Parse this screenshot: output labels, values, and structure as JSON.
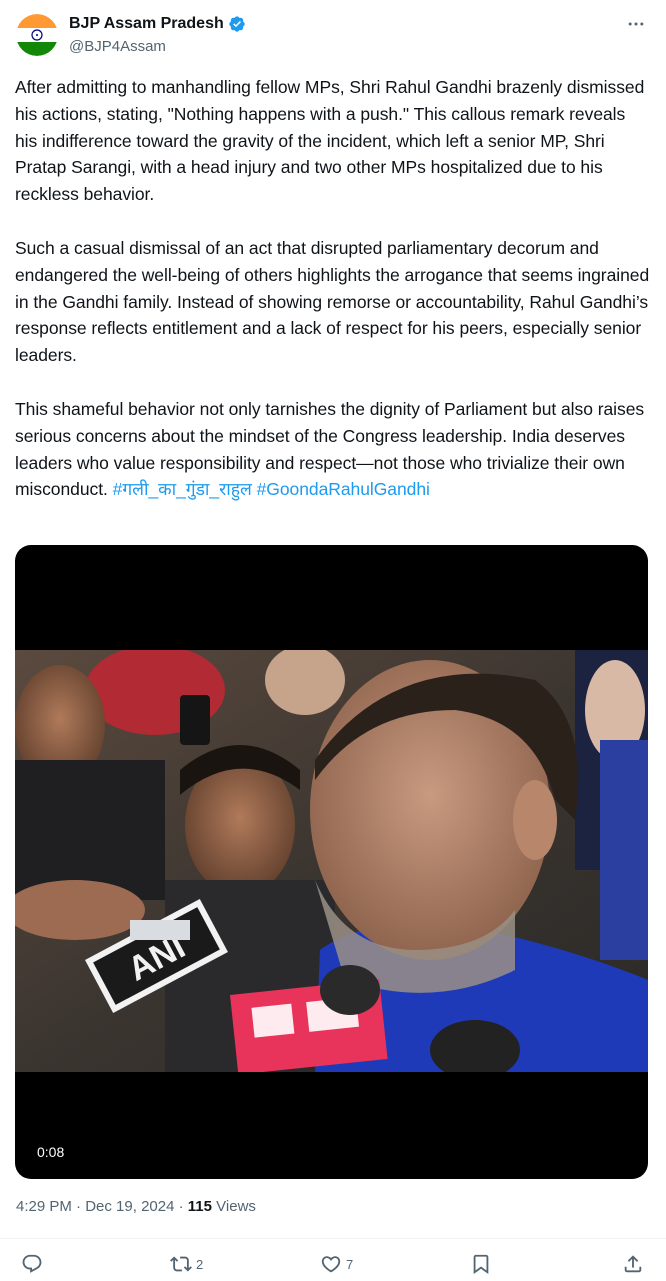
{
  "author": {
    "display_name": "BJP Assam Pradesh",
    "handle": "@BJP4Assam",
    "avatar_icon": "india-flag-avatar-icon",
    "verified_color": "#1d9bf0"
  },
  "tweet": {
    "paragraphs": [
      "After admitting to manhandling fellow MPs, Shri Rahul Gandhi brazenly dismissed his actions, stating, \"Nothing happens with a push.\" This callous remark reveals his indifference toward the gravity of the incident, which left a senior MP, Shri Pratap Sarangi, with a head injury and two other MPs hospitalized due to his reckless behavior.",
      "Such a casual dismissal of an act that disrupted parliamentary decorum and endangered the well-being of others highlights the arrogance that seems ingrained in the Gandhi family. Instead of showing remorse or accountability, Rahul Gandhi’s response reflects entitlement and a lack of respect for his peers, especially senior leaders.",
      "This shameful behavior not only tarnishes the dignity of Parliament but also raises serious concerns about the mindset of the Congress leadership. India deserves leaders who value responsibility and respect—not those who trivialize their own misconduct."
    ],
    "hashtags": [
      "#गली_का_गुंडा_राहुल",
      "#GoondaRahulGandhi"
    ]
  },
  "media": {
    "duration": "0:08",
    "mic_labels": [
      "ANI"
    ]
  },
  "meta": {
    "time": "4:29 PM",
    "separator": " · ",
    "date": "Dec 19, 2024",
    "views_count": "115",
    "views_label": " Views"
  },
  "actions": {
    "replies": "",
    "reposts": "2",
    "likes": "7",
    "accent_color": "#536471"
  }
}
